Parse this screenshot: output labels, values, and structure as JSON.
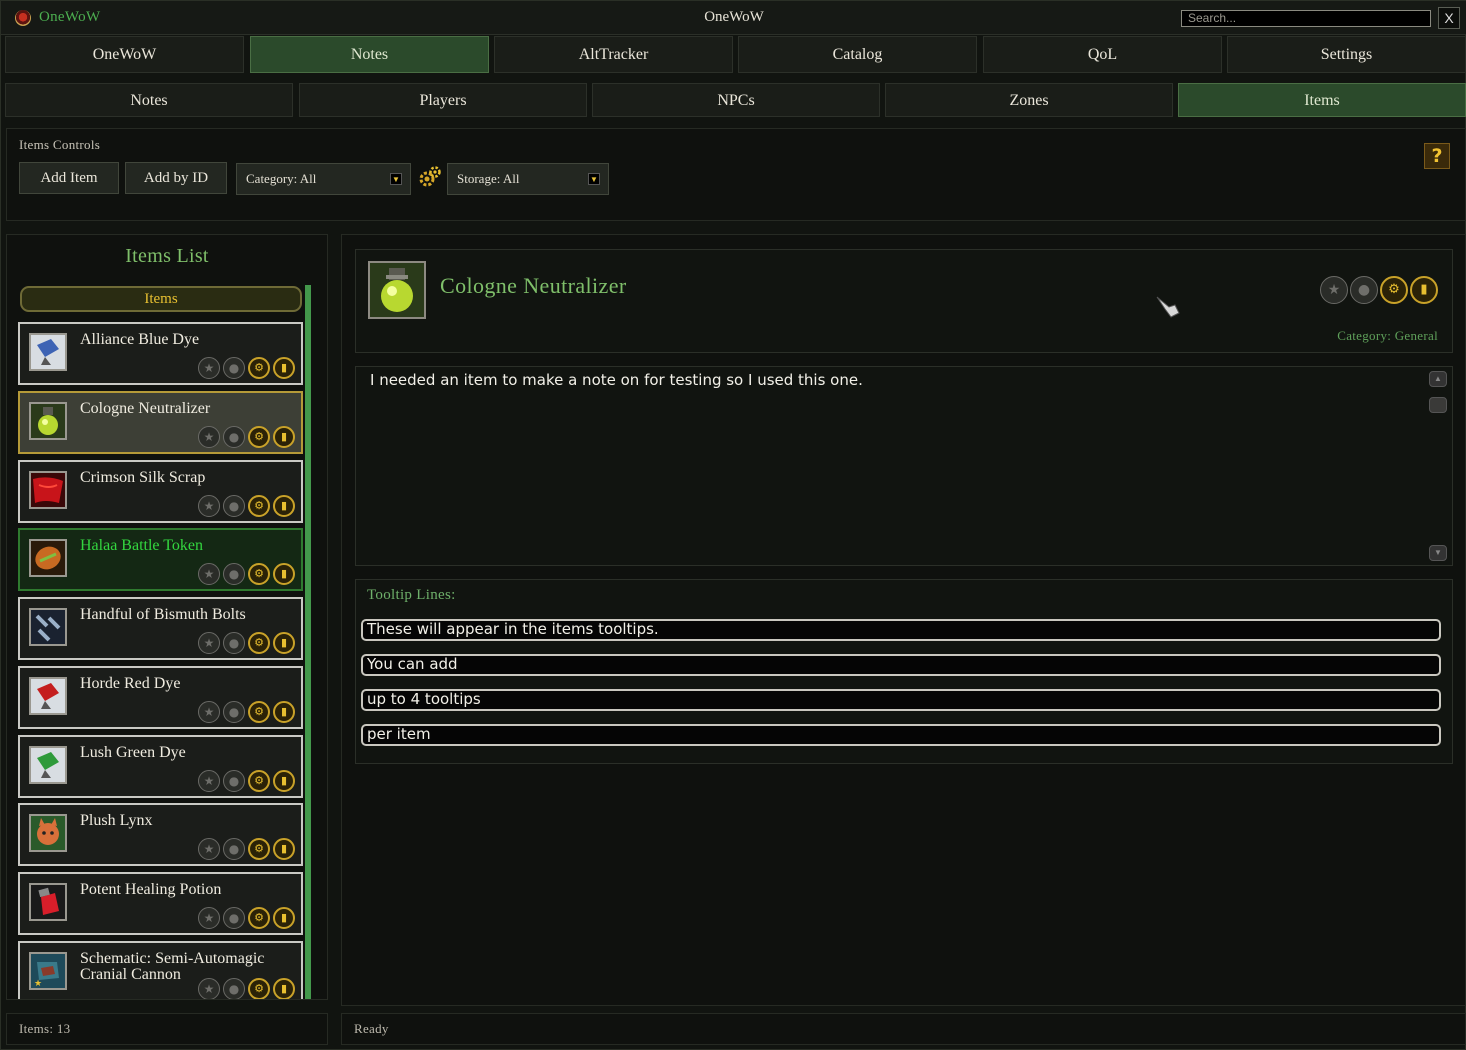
{
  "window": {
    "app_name": "OneWoW",
    "title": "OneWoW",
    "search_placeholder": "Search...",
    "close_label": "X"
  },
  "main_tabs": [
    {
      "label": "OneWoW"
    },
    {
      "label": "Notes"
    },
    {
      "label": "AltTracker"
    },
    {
      "label": "Catalog"
    },
    {
      "label": "QoL"
    },
    {
      "label": "Settings"
    }
  ],
  "sub_tabs": [
    {
      "label": "Notes"
    },
    {
      "label": "Players"
    },
    {
      "label": "NPCs"
    },
    {
      "label": "Zones"
    },
    {
      "label": "Items"
    }
  ],
  "controls": {
    "title": "Items Controls",
    "add_item": "Add Item",
    "add_by_id": "Add by ID",
    "category_dropdown": "Category: All",
    "storage_dropdown": "Storage: All",
    "help": "?"
  },
  "items_list": {
    "title": "Items List",
    "header": "Items",
    "items": [
      {
        "name": "Alliance Blue Dye"
      },
      {
        "name": "Cologne Neutralizer"
      },
      {
        "name": "Crimson Silk Scrap"
      },
      {
        "name": "Halaa Battle Token"
      },
      {
        "name": "Handful of Bismuth Bolts"
      },
      {
        "name": "Horde Red Dye"
      },
      {
        "name": "Lush Green Dye"
      },
      {
        "name": "Plush Lynx"
      },
      {
        "name": "Potent Healing Potion"
      },
      {
        "name": "Schematic: Semi-Automagic Cranial Cannon"
      }
    ]
  },
  "detail": {
    "item_name": "Cologne Neutralizer",
    "category": "Category: General",
    "note": "I needed an item to make a note on for testing so I used this one.",
    "tooltip_label": "Tooltip Lines:",
    "tooltip_lines": [
      "These will appear in the items tooltips.",
      "You can add",
      "up to 4 tooltips",
      "per item"
    ]
  },
  "status": {
    "count": "Items: 13",
    "message": "Ready"
  },
  "colors": {
    "accent_green": "#4caf50",
    "active_tab": "#2b4a2b",
    "gold": "#e8c031"
  }
}
